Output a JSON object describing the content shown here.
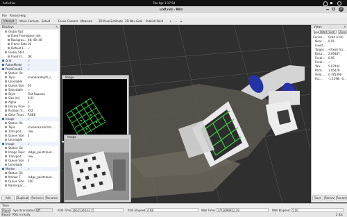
{
  "topbar": {
    "app": "Activities",
    "clock": "Thu Apr 3  17:59"
  },
  "window": {
    "title": "urdf.rviz - RViz"
  },
  "menu": [
    "File",
    "Panels",
    "Help"
  ],
  "toolbar": [
    "Interact",
    "Move Camera",
    "Select",
    "Focus Camera",
    "Measure",
    "2D Pose Estimate",
    "2D Nav Goal",
    "Publish Point"
  ],
  "displays": {
    "title": "Displays",
    "rows": [
      {
        "label": "Global Opt",
        "value": ""
      },
      {
        "label": "Fixed Frame",
        "value": "base_link"
      },
      {
        "label": "Backgrou...",
        "value": "48; 48; 48"
      },
      {
        "label": "Frame Rate",
        "value": "30"
      },
      {
        "label": "Default L...",
        "value": "✓"
      },
      {
        "label": "Global Stat...",
        "value": ""
      },
      {
        "label": "Fixed Fr...",
        "value": "OK"
      },
      {
        "label": "Grid",
        "value": "✓"
      },
      {
        "label": "RobotModel",
        "value": "✓"
      },
      {
        "label": "PointCloud2",
        "value": "✓"
      },
      {
        "label": "Status: Ok",
        "value": ""
      },
      {
        "label": "Topic",
        "value": "/camera/depth_r..."
      },
      {
        "label": "Unreliable",
        "value": ""
      },
      {
        "label": "Queue Size",
        "value": "10"
      },
      {
        "label": "Selectable",
        "value": "✓"
      },
      {
        "label": "Style",
        "value": "Flat Squares"
      },
      {
        "label": "Size (m)",
        "value": "0.01"
      },
      {
        "label": "Alpha",
        "value": "1"
      },
      {
        "label": "Decay Time",
        "value": "0"
      },
      {
        "label": "Position Tr...",
        "value": "XYZ"
      },
      {
        "label": "Color Trans...",
        "value": "RGB8"
      },
      {
        "label": "Image",
        "value": "✓"
      },
      {
        "label": "Status: Ok",
        "value": ""
      },
      {
        "label": "Topic",
        "value": "/camera/color/im..."
      },
      {
        "label": "Transport ...",
        "value": "raw"
      },
      {
        "label": "Queue Size",
        "value": "2"
      },
      {
        "label": "Unreliable",
        "value": ""
      },
      {
        "label": "Image",
        "value": "✓"
      },
      {
        "label": "Status: Ok",
        "value": ""
      },
      {
        "label": "Image Topic",
        "value": "/edge_pointcloud..."
      },
      {
        "label": "Transport ...",
        "value": "raw"
      },
      {
        "label": "Queue Size",
        "value": "2"
      },
      {
        "label": "Unreliable",
        "value": ""
      },
      {
        "label": "Marker",
        "value": "✓"
      },
      {
        "label": "Status: Ok",
        "value": ""
      },
      {
        "label": "Marker T...",
        "value": "/edge_pointcloud..."
      },
      {
        "label": "Queue Size",
        "value": "100"
      },
      {
        "label": "Namespac...",
        "value": ""
      }
    ],
    "buttons": [
      "Add",
      "Duplicate",
      "Remove",
      "Rename"
    ]
  },
  "views": {
    "title": "Views",
    "type_label": "Type:",
    "type_value": "Orbit (rviz)",
    "zero": "Zero",
    "rows": [
      {
        "label": "Curren...",
        "value": "Orbit (rviz)"
      },
      {
        "label": "Near ...",
        "value": "0.01"
      },
      {
        "label": "Invert...",
        "value": ""
      },
      {
        "label": "Target...",
        "value": "<Fixed Fra..."
      },
      {
        "label": "Dista...",
        "value": "2.09487"
      },
      {
        "label": "Focal...",
        "value": "0.05"
      },
      {
        "label": "Focal...",
        "value": "✓"
      },
      {
        "label": "Yaw",
        "value": "5.07404"
      },
      {
        "label": "Pitch",
        "value": "1.05479"
      },
      {
        "label": "Field ...",
        "value": "0.785398"
      },
      {
        "label": "Foc...",
        "value": "-1.1198; -0..."
      }
    ],
    "buttons": [
      "Save",
      "Remove",
      "Rename"
    ]
  },
  "image_panels": [
    {
      "title": "Image"
    },
    {
      "title": "Image"
    }
  ],
  "time": {
    "title": "Time",
    "pause": "Pause",
    "sync_label": "Synchronization:",
    "sync_value": "Off",
    "ros_time_label": "ROS Time:",
    "ros_time_value": "1662534633.15",
    "ros_elapsed_label": "ROS Elapsed:",
    "ros_elapsed_value": "4.98",
    "wall_time_label": "Wall Time:",
    "wall_time_value": "1743699952.39",
    "wall_elapsed_label": "Wall Elapsed:",
    "wall_elapsed_value": "5.00"
  },
  "status": {
    "reset": "Reset",
    "message": "RViz is ready.",
    "fps": "2 fps"
  },
  "colors": {
    "accent": "#3d6fb6",
    "bg_dark": "#2b2b2b",
    "panel": "#f2f2f2"
  }
}
